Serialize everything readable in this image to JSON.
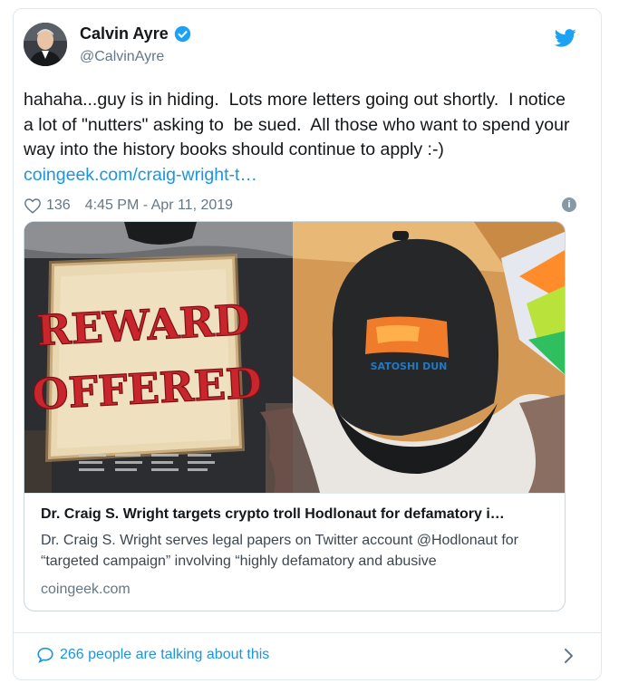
{
  "author": {
    "name": "Calvin Ayre",
    "handle": "@CalvinAyre"
  },
  "tweet": {
    "text": "hahaha...guy is in hiding.  Lots more letters going out shortly.  I notice a lot of \"nutters\" asking to  be sued.  All those who want to spend your way into the history books should continue to apply :-)",
    "link": "coingeek.com/craig-wright-t…"
  },
  "meta": {
    "likes": "136",
    "timestamp": "4:45 PM - Apr 11, 2019"
  },
  "card": {
    "image_left_sign_line1": "REWARD",
    "image_left_sign_line2": "OFFERED",
    "image_right_cap_text": "SATOSHI DUN",
    "title": "Dr. Craig S. Wright targets crypto troll Hodlonaut for defamatory i…",
    "description": "Dr. Craig S. Wright serves legal papers on Twitter account @Hodlonaut for “targeted campaign” involving “highly defamatory and abusive",
    "domain": "coingeek.com"
  },
  "footer": {
    "talking": "266 people are talking about this"
  },
  "colors": {
    "link_blue": "#1b95e0",
    "verified_blue": "#1da1f2",
    "muted": "#657786"
  }
}
